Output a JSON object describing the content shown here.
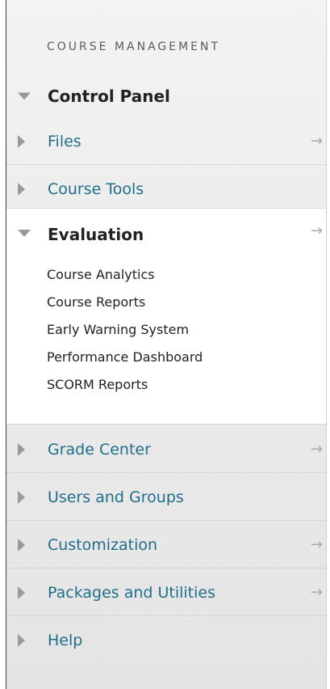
{
  "header": {
    "title": "COURSE MANAGEMENT"
  },
  "control_panel": {
    "label": "Control Panel"
  },
  "items_top": [
    {
      "label": "Files",
      "has_arrow": true
    },
    {
      "label": "Course Tools",
      "has_arrow": false
    }
  ],
  "evaluation": {
    "label": "Evaluation",
    "subitems": [
      "Course Analytics",
      "Course Reports",
      "Early Warning System",
      "Performance Dashboard",
      "SCORM Reports"
    ]
  },
  "items_bottom": [
    {
      "label": "Grade Center",
      "has_arrow": true
    },
    {
      "label": "Users and Groups",
      "has_arrow": false
    },
    {
      "label": "Customization",
      "has_arrow": true
    },
    {
      "label": "Packages and Utilities",
      "has_arrow": true
    },
    {
      "label": "Help",
      "has_arrow": false
    }
  ],
  "icons": {
    "go_arrow": "→"
  },
  "colors": {
    "link": "#1f6e8a",
    "heading": "#222222",
    "header": "#5c5c5c"
  }
}
